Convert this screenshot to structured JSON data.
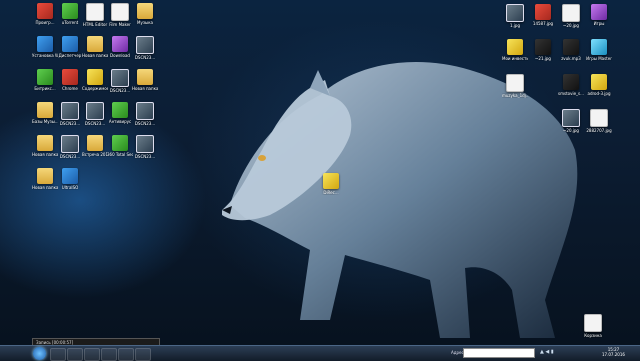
{
  "desktop": {
    "left_icons": [
      {
        "label": "Проигр...",
        "col": 0,
        "row": 0,
        "style": "red"
      },
      {
        "label": "uTorrent",
        "col": 1,
        "row": 0,
        "style": "green"
      },
      {
        "label": "HTML Editor",
        "col": 2,
        "row": 0,
        "style": "white"
      },
      {
        "label": "Film Maker",
        "col": 3,
        "row": 0,
        "style": "white"
      },
      {
        "label": "Музыка",
        "col": 4,
        "row": 0,
        "style": "folder"
      },
      {
        "label": "Установка Windows",
        "col": 0,
        "row": 1,
        "style": "blue"
      },
      {
        "label": "Диспетчер",
        "col": 1,
        "row": 1,
        "style": "blue"
      },
      {
        "label": "Новая папка",
        "col": 2,
        "row": 1,
        "style": "folder"
      },
      {
        "label": "Download",
        "col": 3,
        "row": 1,
        "style": "purple"
      },
      {
        "label": "DSCN23...",
        "col": 4,
        "row": 1,
        "style": "img"
      },
      {
        "label": "Битрикс...",
        "col": 0,
        "row": 2,
        "style": "green"
      },
      {
        "label": "Chrome",
        "col": 1,
        "row": 2,
        "style": "red"
      },
      {
        "label": "Содержимое",
        "col": 2,
        "row": 2,
        "style": "yellow"
      },
      {
        "label": "DSCN23...",
        "col": 3,
        "row": 2,
        "style": "img"
      },
      {
        "label": "Новая папка",
        "col": 4,
        "row": 2,
        "style": "folder"
      },
      {
        "label": "Базы Музы...",
        "col": 0,
        "row": 3,
        "style": "folder"
      },
      {
        "label": "DSCN23...",
        "col": 1,
        "row": 3,
        "style": "img"
      },
      {
        "label": "DSCN23...",
        "col": 2,
        "row": 3,
        "style": "img"
      },
      {
        "label": "Антивирус",
        "col": 3,
        "row": 3,
        "style": "green"
      },
      {
        "label": "DSCN23...",
        "col": 4,
        "row": 3,
        "style": "img"
      },
      {
        "label": "Новая папка",
        "col": 0,
        "row": 4,
        "style": "folder"
      },
      {
        "label": "DSCN23...",
        "col": 1,
        "row": 4,
        "style": "img"
      },
      {
        "label": "Встреча 2016",
        "col": 2,
        "row": 4,
        "style": "folder"
      },
      {
        "label": "360 Total Security",
        "col": 3,
        "row": 4,
        "style": "green"
      },
      {
        "label": "DSCN23...",
        "col": 4,
        "row": 4,
        "style": "img"
      },
      {
        "label": "Новая папка (2)",
        "col": 0,
        "row": 5,
        "style": "folder"
      },
      {
        "label": "UltraISO",
        "col": 1,
        "row": 5,
        "style": "blue"
      }
    ],
    "right_icons": [
      {
        "label": "1.jpg",
        "col": 0,
        "row": 0,
        "style": "img"
      },
      {
        "label": "14587.jpg",
        "col": 1,
        "row": 0,
        "style": "red"
      },
      {
        "label": "~20.jpg",
        "col": 2,
        "row": 0,
        "style": "white"
      },
      {
        "label": "Игры",
        "col": 3,
        "row": 0,
        "style": "purple"
      },
      {
        "label": "Мои инвестиции",
        "col": 0,
        "row": 1,
        "style": "yellow"
      },
      {
        "label": "~21.jpg",
        "col": 1,
        "row": 1,
        "style": "dark"
      },
      {
        "label": "zvuk.mp3",
        "col": 2,
        "row": 1,
        "style": "dark"
      },
      {
        "label": "Игры Master",
        "col": 3,
        "row": 1,
        "style": "cyan"
      },
      {
        "label": "muzyka_1dj...",
        "col": 0,
        "row": 2,
        "style": "white"
      },
      {
        "label": "smstovie_s...",
        "col": 2,
        "row": 2,
        "style": "dark"
      },
      {
        "label": "adrod-3.jpg",
        "col": 3,
        "row": 2,
        "style": "yellow"
      },
      {
        "label": "~20.jpg",
        "col": 2,
        "row": 3,
        "style": "img"
      },
      {
        "label": "2882707.jpg",
        "col": 3,
        "row": 3,
        "style": "white"
      }
    ],
    "center_icon": {
      "label": "DiRec...",
      "style": "yellow"
    },
    "recycle_bin": {
      "label": "Корзина"
    }
  },
  "recording_bar": {
    "text": "Запись [00:00:57]"
  },
  "taskbar": {
    "address_label": "Адрес",
    "clock_time": "15:27",
    "clock_date": "17.07.2016",
    "buttons": [
      "explorer",
      "opera",
      "chrome",
      "files",
      "yandex",
      "yandex-browser"
    ]
  }
}
